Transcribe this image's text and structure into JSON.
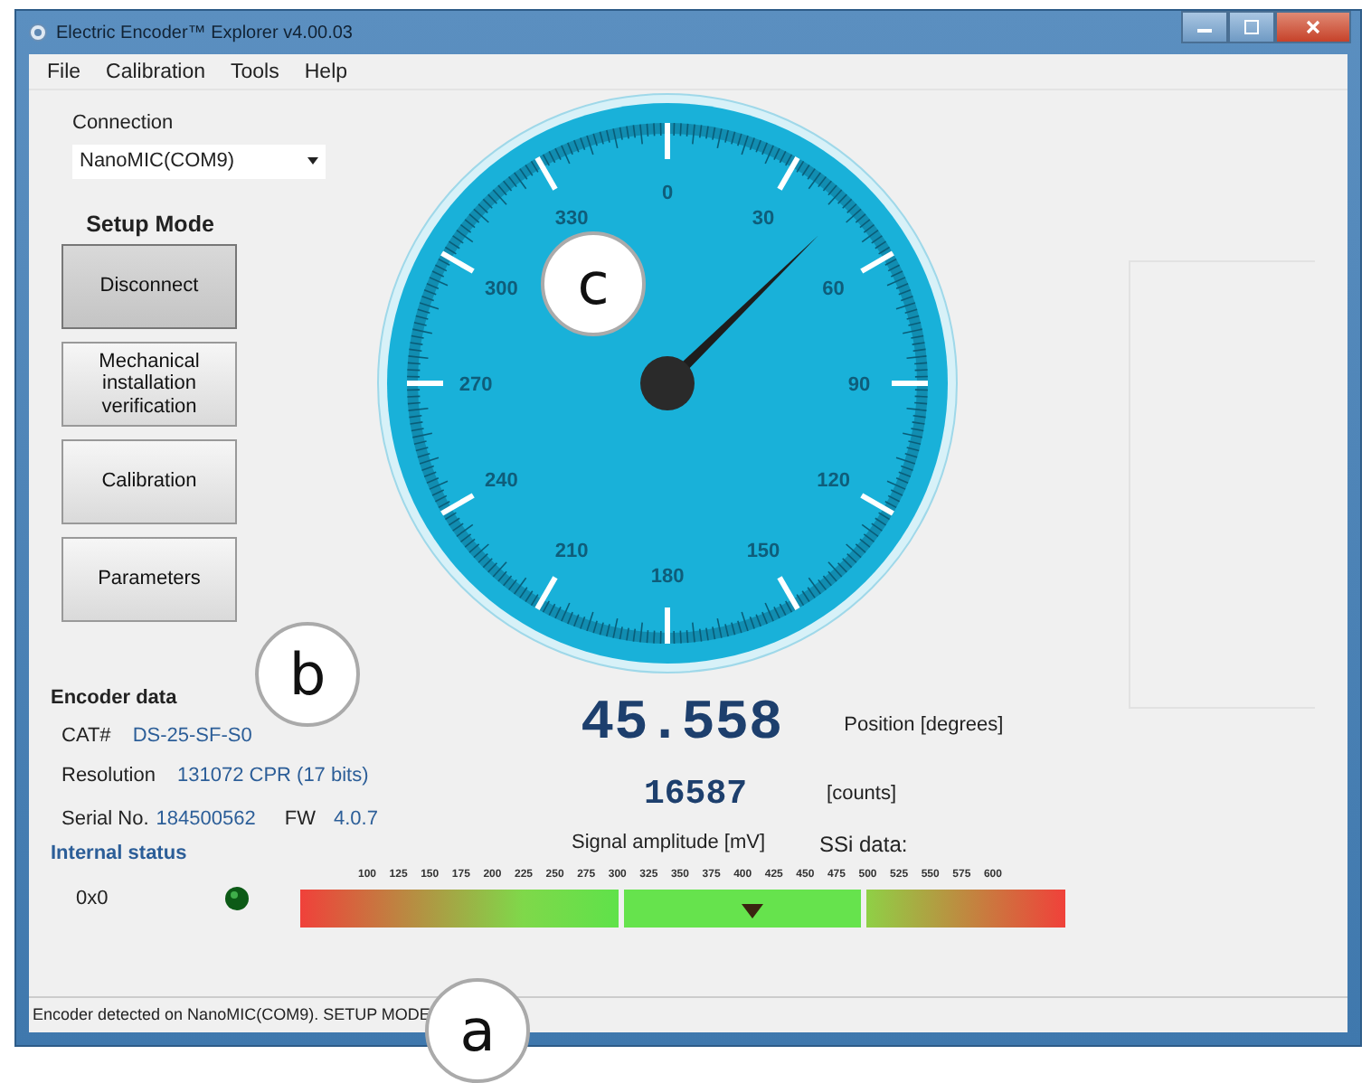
{
  "window": {
    "title": "Electric Encoder™ Explorer v4.00.03"
  },
  "menu": [
    "File",
    "Calibration",
    "Tools",
    "Help"
  ],
  "connection": {
    "label": "Connection",
    "value": "NanoMIC(COM9)"
  },
  "setup": {
    "title": "Setup Mode",
    "buttons": [
      {
        "label": "Disconnect",
        "selected": true
      },
      {
        "label": "Mechanical installation verification",
        "selected": false
      },
      {
        "label": "Calibration",
        "selected": false
      },
      {
        "label": "Parameters",
        "selected": false
      }
    ]
  },
  "encoder_data": {
    "title": "Encoder data",
    "cat_label": "CAT#",
    "cat": "DS-25-SF-S0",
    "resolution_label": "Resolution",
    "resolution": "131072 CPR (17 bits)",
    "serial_label": "Serial No.",
    "serial": "184500562",
    "fw_label": "FW",
    "fw": "4.0.7"
  },
  "internal_status": {
    "title": "Internal status",
    "code": "0x0",
    "led_on": true
  },
  "gauge": {
    "dial_labels": [
      "0",
      "30",
      "60",
      "90",
      "120",
      "150",
      "180",
      "210",
      "240",
      "270",
      "300",
      "330"
    ]
  },
  "position": {
    "degrees": "45.558",
    "degrees_unit": "Position [degrees]",
    "counts": "16587",
    "counts_unit": "[counts]"
  },
  "signal": {
    "label": "Signal amplitude [mV]",
    "ssi_label": "SSi data:",
    "scale": [
      "100",
      "125",
      "150",
      "175",
      "200",
      "225",
      "250",
      "275",
      "300",
      "325",
      "350",
      "375",
      "400",
      "425",
      "450",
      "475",
      "500",
      "525",
      "550",
      "575",
      "600"
    ],
    "level": 0.59
  },
  "status_bar": {
    "text": "Encoder detected on NanoMIC(COM9). SETUP MODE"
  },
  "callouts": [
    "a",
    "b",
    "c"
  ]
}
